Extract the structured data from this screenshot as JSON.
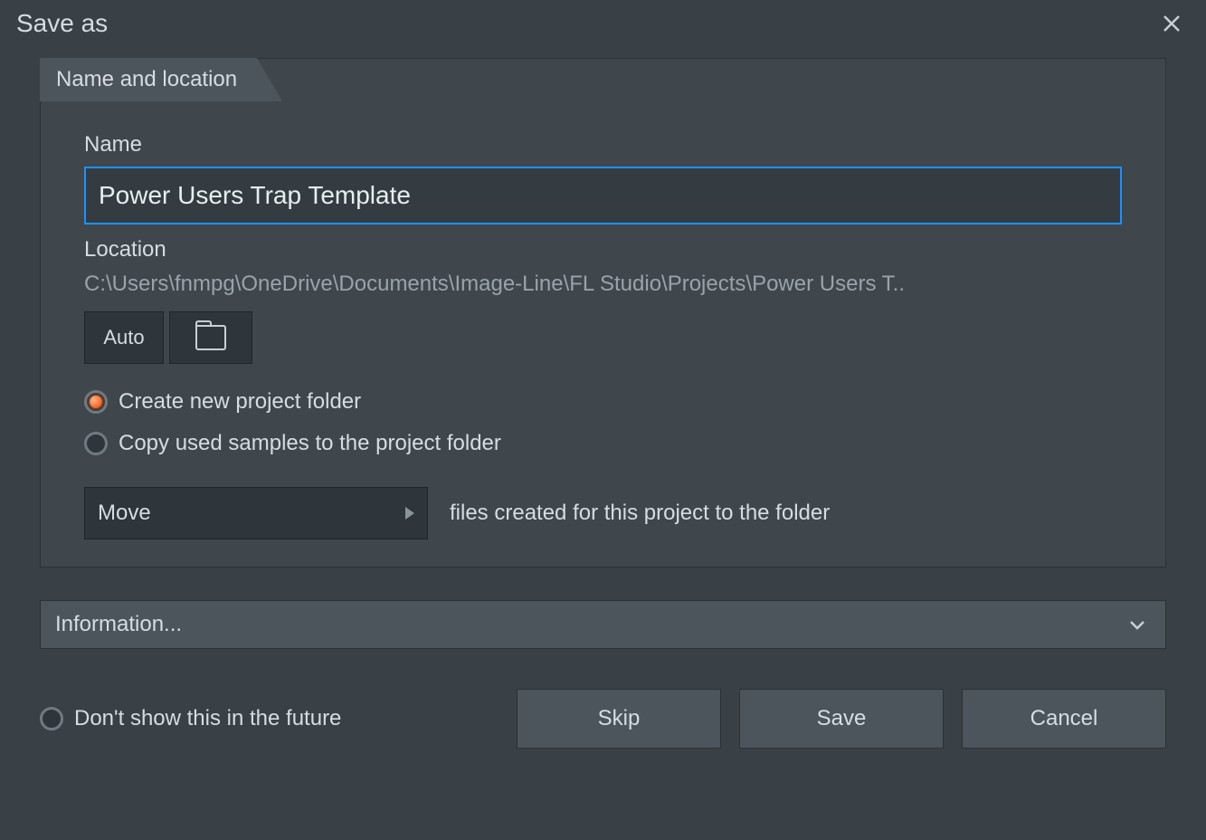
{
  "dialog": {
    "title": "Save as"
  },
  "section": {
    "tab_label": "Name and location",
    "name_label": "Name",
    "name_value": "Power Users Trap Template",
    "location_label": "Location",
    "location_path": "C:\\Users\\fnmpg\\OneDrive\\Documents\\Image-Line\\FL Studio\\Projects\\Power Users T..",
    "auto_label": "Auto",
    "create_folder_label": "Create new project folder",
    "copy_samples_label": "Copy used samples to the project folder",
    "move_dropdown_value": "Move",
    "move_trail_text": "files created for this project to the folder"
  },
  "info": {
    "header": "Information..."
  },
  "footer": {
    "dont_show_label": "Don't show this in the future",
    "skip_label": "Skip",
    "save_label": "Save",
    "cancel_label": "Cancel"
  }
}
